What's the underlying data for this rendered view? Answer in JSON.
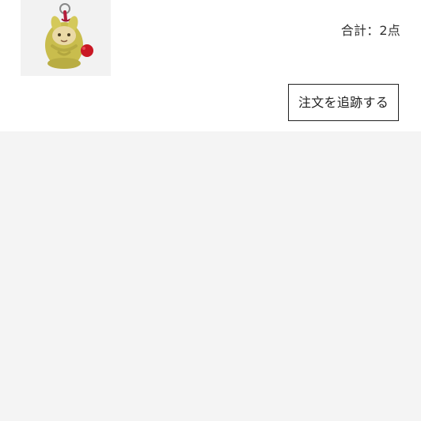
{
  "order": {
    "total_label": "合計：2点",
    "track_button_label": "注文を追跡する"
  },
  "product": {
    "image_icon": "keychain-plush-figure"
  }
}
